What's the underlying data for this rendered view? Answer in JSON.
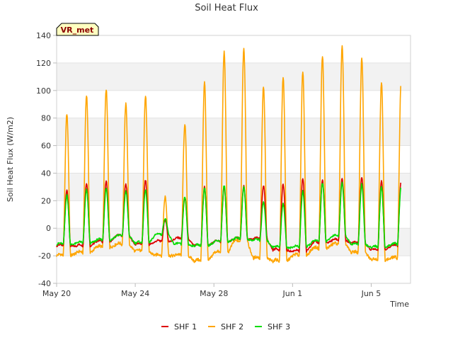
{
  "chart_data": {
    "type": "line",
    "title": "Soil Heat Flux",
    "xlabel": "Time",
    "ylabel": "Soil Heat Flux (W/m2)",
    "badge": "VR_met",
    "xlim": [
      "2024-05-20",
      "2024-06-07"
    ],
    "x_tick_labels": [
      "May 20",
      "May 24",
      "May 28",
      "Jun 1",
      "Jun 5"
    ],
    "x_tick_dates": [
      "2024-05-20",
      "2024-05-24",
      "2024-05-28",
      "2024-06-01",
      "2024-06-05"
    ],
    "ylim": [
      -40,
      140
    ],
    "y_ticks": [
      -40,
      -20,
      0,
      20,
      40,
      60,
      80,
      100,
      120,
      140
    ],
    "grid": "horizontal bands",
    "legend_position": "bottom-center",
    "days": [
      "May 20",
      "May 21",
      "May 22",
      "May 23",
      "May 24",
      "May 25",
      "May 26",
      "May 27",
      "May 28",
      "May 29",
      "May 30",
      "May 31",
      "Jun 1",
      "Jun 2",
      "Jun 3",
      "Jun 4",
      "Jun 5",
      "Jun 6"
    ],
    "series": [
      {
        "name": "SHF 1",
        "color": "#dd0000",
        "daily_min": [
          -13,
          -13,
          -10,
          -6,
          -12,
          -10,
          -8,
          -13,
          -10,
          -8,
          -8,
          -16,
          -17,
          -11,
          -9,
          -11,
          -16,
          -13
        ],
        "daily_max": [
          28,
          33,
          34,
          32,
          35,
          6,
          22,
          30,
          30,
          31,
          31,
          32,
          36,
          35,
          36,
          37,
          34,
          34
        ]
      },
      {
        "name": "SHF 2",
        "color": "#ffa500",
        "daily_min": [
          -20,
          -18,
          -14,
          -12,
          -17,
          -20,
          -20,
          -24,
          -18,
          -10,
          -22,
          -24,
          -20,
          -15,
          -12,
          -18,
          -23,
          -22
        ],
        "daily_max": [
          83,
          97,
          101,
          90,
          96,
          23,
          76,
          106,
          128,
          131,
          103,
          110,
          113,
          125,
          132,
          124,
          106,
          106
        ]
      },
      {
        "name": "SHF 3",
        "color": "#00dd00",
        "daily_min": [
          -12,
          -11,
          -9,
          -6,
          -11,
          -5,
          -12,
          -13,
          -10,
          -8,
          -9,
          -14,
          -14,
          -10,
          -6,
          -12,
          -14,
          -12
        ],
        "daily_max": [
          24,
          28,
          29,
          27,
          28,
          7,
          23,
          29,
          31,
          30,
          19,
          18,
          27,
          33,
          33,
          32,
          30,
          30
        ]
      }
    ]
  }
}
